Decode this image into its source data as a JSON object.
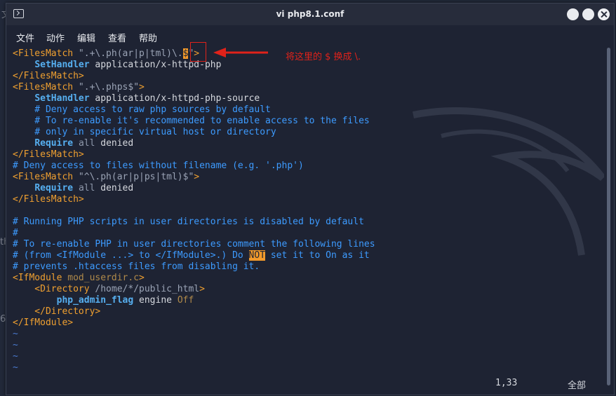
{
  "window": {
    "title": "vi php8.1.conf"
  },
  "menu": [
    "文件",
    "动作",
    "编辑",
    "查看",
    "帮助"
  ],
  "editor": {
    "lines": [
      [
        {
          "t": "<FilesMatch ",
          "c": "tag"
        },
        {
          "t": "\".+\\.ph(ar|p|tml)\\.",
          "c": "str"
        },
        {
          "t": "$",
          "c": "hl"
        },
        {
          "t": "\"",
          "c": "str"
        },
        {
          "t": ">",
          "c": "tag"
        }
      ],
      [
        {
          "t": "    ",
          "c": ""
        },
        {
          "t": "SetHandler",
          "c": "dir"
        },
        {
          "t": " application/x-httpd-php",
          "c": ""
        }
      ],
      [
        {
          "t": "</FilesMatch>",
          "c": "tag"
        }
      ],
      [
        {
          "t": "<FilesMatch ",
          "c": "tag"
        },
        {
          "t": "\".+\\.phps$\"",
          "c": "str"
        },
        {
          "t": ">",
          "c": "tag"
        }
      ],
      [
        {
          "t": "    ",
          "c": ""
        },
        {
          "t": "SetHandler",
          "c": "dir"
        },
        {
          "t": " application/x-httpd-php-source",
          "c": ""
        }
      ],
      [
        {
          "t": "    # Deny access to raw php sources by default",
          "c": "cmt"
        }
      ],
      [
        {
          "t": "    # To re-enable it's recommended to enable access to the files",
          "c": "cmt"
        }
      ],
      [
        {
          "t": "    # only in specific virtual host or directory",
          "c": "cmt"
        }
      ],
      [
        {
          "t": "    ",
          "c": ""
        },
        {
          "t": "Require",
          "c": "dir"
        },
        {
          "t": " ",
          "c": ""
        },
        {
          "t": "all",
          "c": "kw"
        },
        {
          "t": " denied",
          "c": ""
        }
      ],
      [
        {
          "t": "</FilesMatch>",
          "c": "tag"
        }
      ],
      [
        {
          "t": "# Deny access to files without filename (e.g. '.php')",
          "c": "cmt"
        }
      ],
      [
        {
          "t": "<FilesMatch ",
          "c": "tag"
        },
        {
          "t": "\"^\\.ph(ar|p|ps|tml)$\"",
          "c": "str"
        },
        {
          "t": ">",
          "c": "tag"
        }
      ],
      [
        {
          "t": "    ",
          "c": ""
        },
        {
          "t": "Require",
          "c": "dir"
        },
        {
          "t": " ",
          "c": ""
        },
        {
          "t": "all",
          "c": "kw"
        },
        {
          "t": " denied",
          "c": ""
        }
      ],
      [
        {
          "t": "</FilesMatch>",
          "c": "tag"
        }
      ],
      [
        {
          "t": "",
          "c": ""
        }
      ],
      [
        {
          "t": "# Running PHP scripts in user directories is disabled by default",
          "c": "cmt"
        }
      ],
      [
        {
          "t": "#",
          "c": "cmt"
        }
      ],
      [
        {
          "t": "# To re-enable PHP in user directories comment the following lines",
          "c": "cmt"
        }
      ],
      [
        {
          "t": "# (from <IfModule ...> to </IfModule>.) Do ",
          "c": "cmt"
        },
        {
          "t": "NOT",
          "c": "hl"
        },
        {
          "t": " set it to On as it",
          "c": "cmt"
        }
      ],
      [
        {
          "t": "# prevents .htaccess files from disabling it.",
          "c": "cmt"
        }
      ],
      [
        {
          "t": "<IfModule ",
          "c": "tag"
        },
        {
          "t": "mod_userdir.c",
          "c": "val"
        },
        {
          "t": ">",
          "c": "tag"
        }
      ],
      [
        {
          "t": "    <Directory ",
          "c": "tag"
        },
        {
          "t": "/home/*/public_html",
          "c": "str"
        },
        {
          "t": ">",
          "c": "tag"
        }
      ],
      [
        {
          "t": "        ",
          "c": ""
        },
        {
          "t": "php_admin_flag",
          "c": "dir"
        },
        {
          "t": " engine ",
          "c": ""
        },
        {
          "t": "Off",
          "c": "val"
        }
      ],
      [
        {
          "t": "    </Directory>",
          "c": "tag"
        }
      ],
      [
        {
          "t": "</IfModule>",
          "c": "tag"
        }
      ],
      [
        {
          "t": "~",
          "c": "tilde"
        }
      ],
      [
        {
          "t": "~",
          "c": "tilde"
        }
      ],
      [
        {
          "t": "~",
          "c": "tilde"
        }
      ],
      [
        {
          "t": "~",
          "c": "tilde"
        }
      ]
    ],
    "cursor_pos": "1,33",
    "scroll_pos": "全部"
  },
  "annotation": {
    "text": "将这里的 $ 换成 \\."
  },
  "colors": {
    "annotation": "#e0221a",
    "highlight": "#f29a2b",
    "background": "#1e2333"
  }
}
